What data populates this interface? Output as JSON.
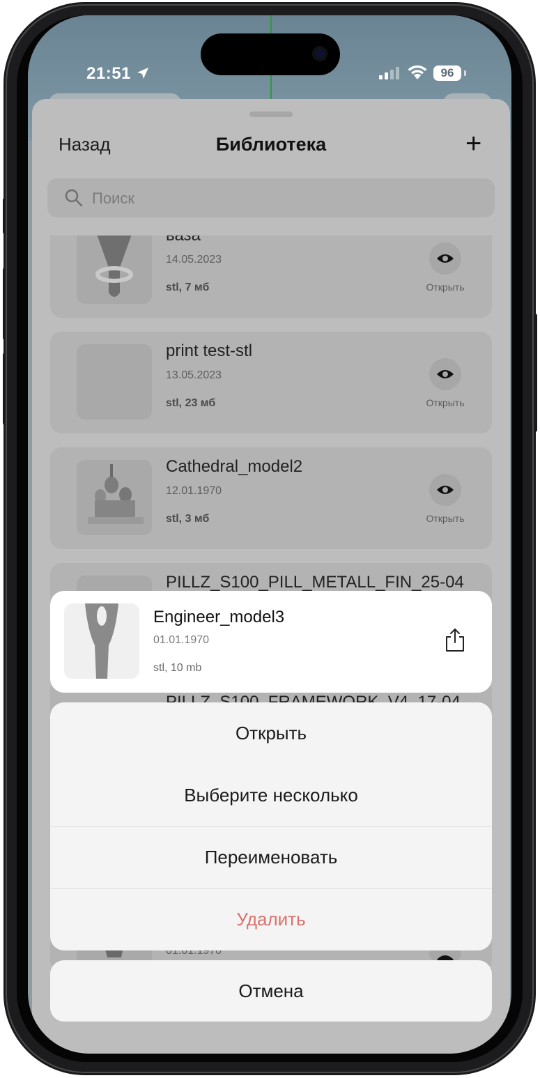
{
  "status_bar": {
    "time": "21:51",
    "battery": "96"
  },
  "nav": {
    "back_label": "Назад",
    "title": "Библиотека",
    "add_label": "+"
  },
  "search": {
    "placeholder": "Поиск"
  },
  "library": {
    "items": [
      {
        "name": "ваза",
        "date": "14.05.2023",
        "meta": "stl, 7 мб",
        "open_label": "Открыть"
      },
      {
        "name": "print test-stl",
        "date": "13.05.2023",
        "meta": "stl, 23 мб",
        "open_label": "Открыть"
      },
      {
        "name": "Cathedral_model2",
        "date": "12.01.1970",
        "meta": "stl, 3 мб",
        "open_label": "Открыть"
      },
      {
        "name": "PILLZ_S100_PILL_METALL_FIN_25-04",
        "date": "",
        "meta": "",
        "open_label": ""
      },
      {
        "name": "PILLZ_S100_FRAMEWORK_V4_17-04",
        "date": "01.01.1970",
        "meta": "",
        "open_label": ""
      }
    ]
  },
  "preview": {
    "name": "Engineer_model3",
    "date": "01.01.1970",
    "meta": "stl, 10 mb"
  },
  "actions": {
    "open": "Открыть",
    "select_multiple": "Выберите несколько",
    "rename": "Переименовать",
    "delete": "Удалить",
    "cancel": "Отмена"
  },
  "colors": {
    "danger": "#d9736c",
    "sheet_bg": "#bdbdbd",
    "action_bg": "#f4f4f4"
  },
  "icons": [
    "location-arrow-icon",
    "signal-icon",
    "wifi-icon",
    "plus-icon",
    "search-icon",
    "eye-icon",
    "share-icon"
  ]
}
